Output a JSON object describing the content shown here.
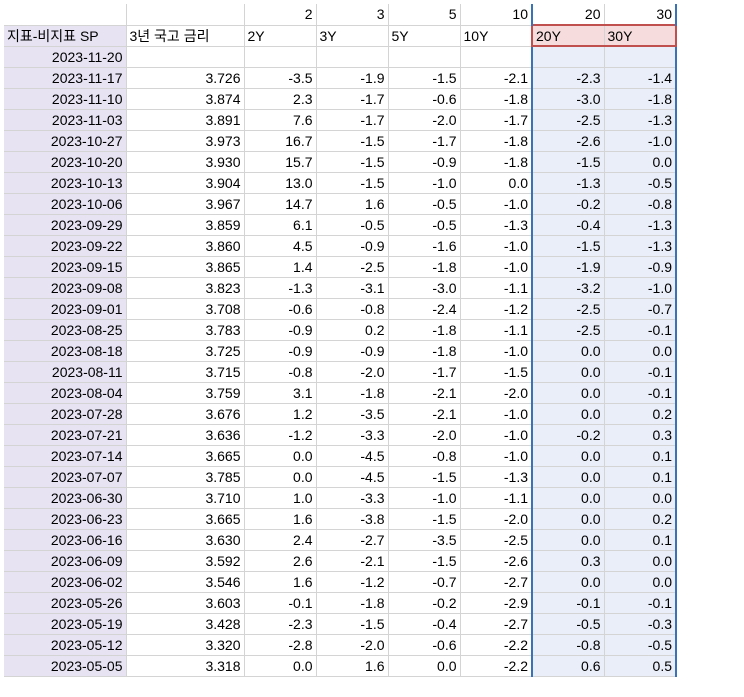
{
  "col_numbers": [
    "",
    "",
    "2",
    "3",
    "5",
    "10",
    "20",
    "30"
  ],
  "headers": [
    "지표-비지표 SP",
    "3년 국고 금리",
    "2Y",
    "3Y",
    "5Y",
    "10Y",
    "20Y",
    "30Y"
  ],
  "rows": [
    [
      "2023-11-20",
      "",
      "",
      "",
      "",
      "",
      "",
      ""
    ],
    [
      "2023-11-17",
      "3.726",
      "-3.5",
      "-1.9",
      "-1.5",
      "-2.1",
      "-2.3",
      "-1.4"
    ],
    [
      "2023-11-10",
      "3.874",
      "2.3",
      "-1.7",
      "-0.6",
      "-1.8",
      "-3.0",
      "-1.8"
    ],
    [
      "2023-11-03",
      "3.891",
      "7.6",
      "-1.7",
      "-2.0",
      "-1.7",
      "-2.5",
      "-1.3"
    ],
    [
      "2023-10-27",
      "3.973",
      "16.7",
      "-1.5",
      "-1.7",
      "-1.8",
      "-2.6",
      "-1.0"
    ],
    [
      "2023-10-20",
      "3.930",
      "15.7",
      "-1.5",
      "-0.9",
      "-1.8",
      "-1.5",
      "0.0"
    ],
    [
      "2023-10-13",
      "3.904",
      "13.0",
      "-1.5",
      "-1.0",
      "0.0",
      "-1.3",
      "-0.5"
    ],
    [
      "2023-10-06",
      "3.967",
      "14.7",
      "1.6",
      "-0.5",
      "-1.0",
      "-0.2",
      "-0.8"
    ],
    [
      "2023-09-29",
      "3.859",
      "6.1",
      "-0.5",
      "-0.5",
      "-1.3",
      "-0.4",
      "-1.3"
    ],
    [
      "2023-09-22",
      "3.860",
      "4.5",
      "-0.9",
      "-1.6",
      "-1.0",
      "-1.5",
      "-1.3"
    ],
    [
      "2023-09-15",
      "3.865",
      "1.4",
      "-2.5",
      "-1.8",
      "-1.0",
      "-1.9",
      "-0.9"
    ],
    [
      "2023-09-08",
      "3.823",
      "-1.3",
      "-3.1",
      "-3.0",
      "-1.1",
      "-3.2",
      "-1.0"
    ],
    [
      "2023-09-01",
      "3.708",
      "-0.6",
      "-0.8",
      "-2.4",
      "-1.2",
      "-2.5",
      "-0.7"
    ],
    [
      "2023-08-25",
      "3.783",
      "-0.9",
      "0.2",
      "-1.8",
      "-1.1",
      "-2.5",
      "-0.1"
    ],
    [
      "2023-08-18",
      "3.725",
      "-0.9",
      "-0.9",
      "-1.8",
      "-1.0",
      "0.0",
      "0.0"
    ],
    [
      "2023-08-11",
      "3.715",
      "-0.8",
      "-2.0",
      "-1.7",
      "-1.5",
      "0.0",
      "-0.1"
    ],
    [
      "2023-08-04",
      "3.759",
      "3.1",
      "-1.8",
      "-2.1",
      "-2.0",
      "0.0",
      "-0.1"
    ],
    [
      "2023-07-28",
      "3.676",
      "1.2",
      "-3.5",
      "-2.1",
      "-1.0",
      "0.0",
      "0.2"
    ],
    [
      "2023-07-21",
      "3.636",
      "-1.2",
      "-3.3",
      "-2.0",
      "-1.0",
      "-0.2",
      "0.3"
    ],
    [
      "2023-07-14",
      "3.665",
      "0.0",
      "-4.5",
      "-0.8",
      "-1.0",
      "0.0",
      "0.1"
    ],
    [
      "2023-07-07",
      "3.785",
      "0.0",
      "-4.5",
      "-1.5",
      "-1.3",
      "0.0",
      "0.1"
    ],
    [
      "2023-06-30",
      "3.710",
      "1.0",
      "-3.3",
      "-1.0",
      "-1.1",
      "0.0",
      "0.0"
    ],
    [
      "2023-06-23",
      "3.665",
      "1.6",
      "-3.8",
      "-1.5",
      "-2.0",
      "0.0",
      "0.2"
    ],
    [
      "2023-06-16",
      "3.630",
      "2.4",
      "-2.7",
      "-3.5",
      "-2.5",
      "0.0",
      "0.1"
    ],
    [
      "2023-06-09",
      "3.592",
      "2.6",
      "-2.1",
      "-1.5",
      "-2.6",
      "0.3",
      "0.0"
    ],
    [
      "2023-06-02",
      "3.546",
      "1.6",
      "-1.2",
      "-0.7",
      "-2.7",
      "0.0",
      "0.0"
    ],
    [
      "2023-05-26",
      "3.603",
      "-0.1",
      "-1.8",
      "-0.2",
      "-2.9",
      "-0.1",
      "-0.1"
    ],
    [
      "2023-05-19",
      "3.428",
      "-2.3",
      "-1.5",
      "-0.4",
      "-2.7",
      "-0.5",
      "-0.3"
    ],
    [
      "2023-05-12",
      "3.320",
      "-2.8",
      "-2.0",
      "-0.6",
      "-2.2",
      "-0.8",
      "-0.5"
    ],
    [
      "2023-05-05",
      "3.318",
      "0.0",
      "1.6",
      "0.0",
      "-2.2",
      "0.6",
      "0.5"
    ]
  ],
  "colors": {
    "date_bg": "#e7e3f3",
    "selection_bg": "#e9eef8",
    "selection_border": "#3a72b8",
    "red_border": "#c0504d"
  }
}
